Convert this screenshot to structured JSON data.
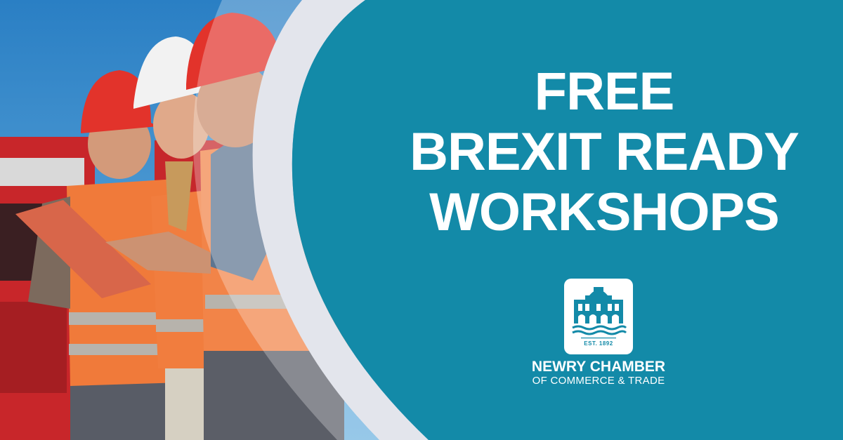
{
  "headline": {
    "line1": "FREE",
    "line2": "BREXIT READY",
    "line3": "WORKSHOPS"
  },
  "logo": {
    "est_text": "EST. 1892",
    "org_name": "NEWRY CHAMBER",
    "org_subtitle": "OF COMMERCE & TRADE"
  },
  "colors": {
    "teal_panel": "#138aa8",
    "white_arc": "#e3e5ec",
    "sky": "#2f88c6",
    "vest_orange": "#f07a3a",
    "hardhat_red": "#e2332b"
  },
  "photo": {
    "icon": "construction-workers-photo"
  }
}
